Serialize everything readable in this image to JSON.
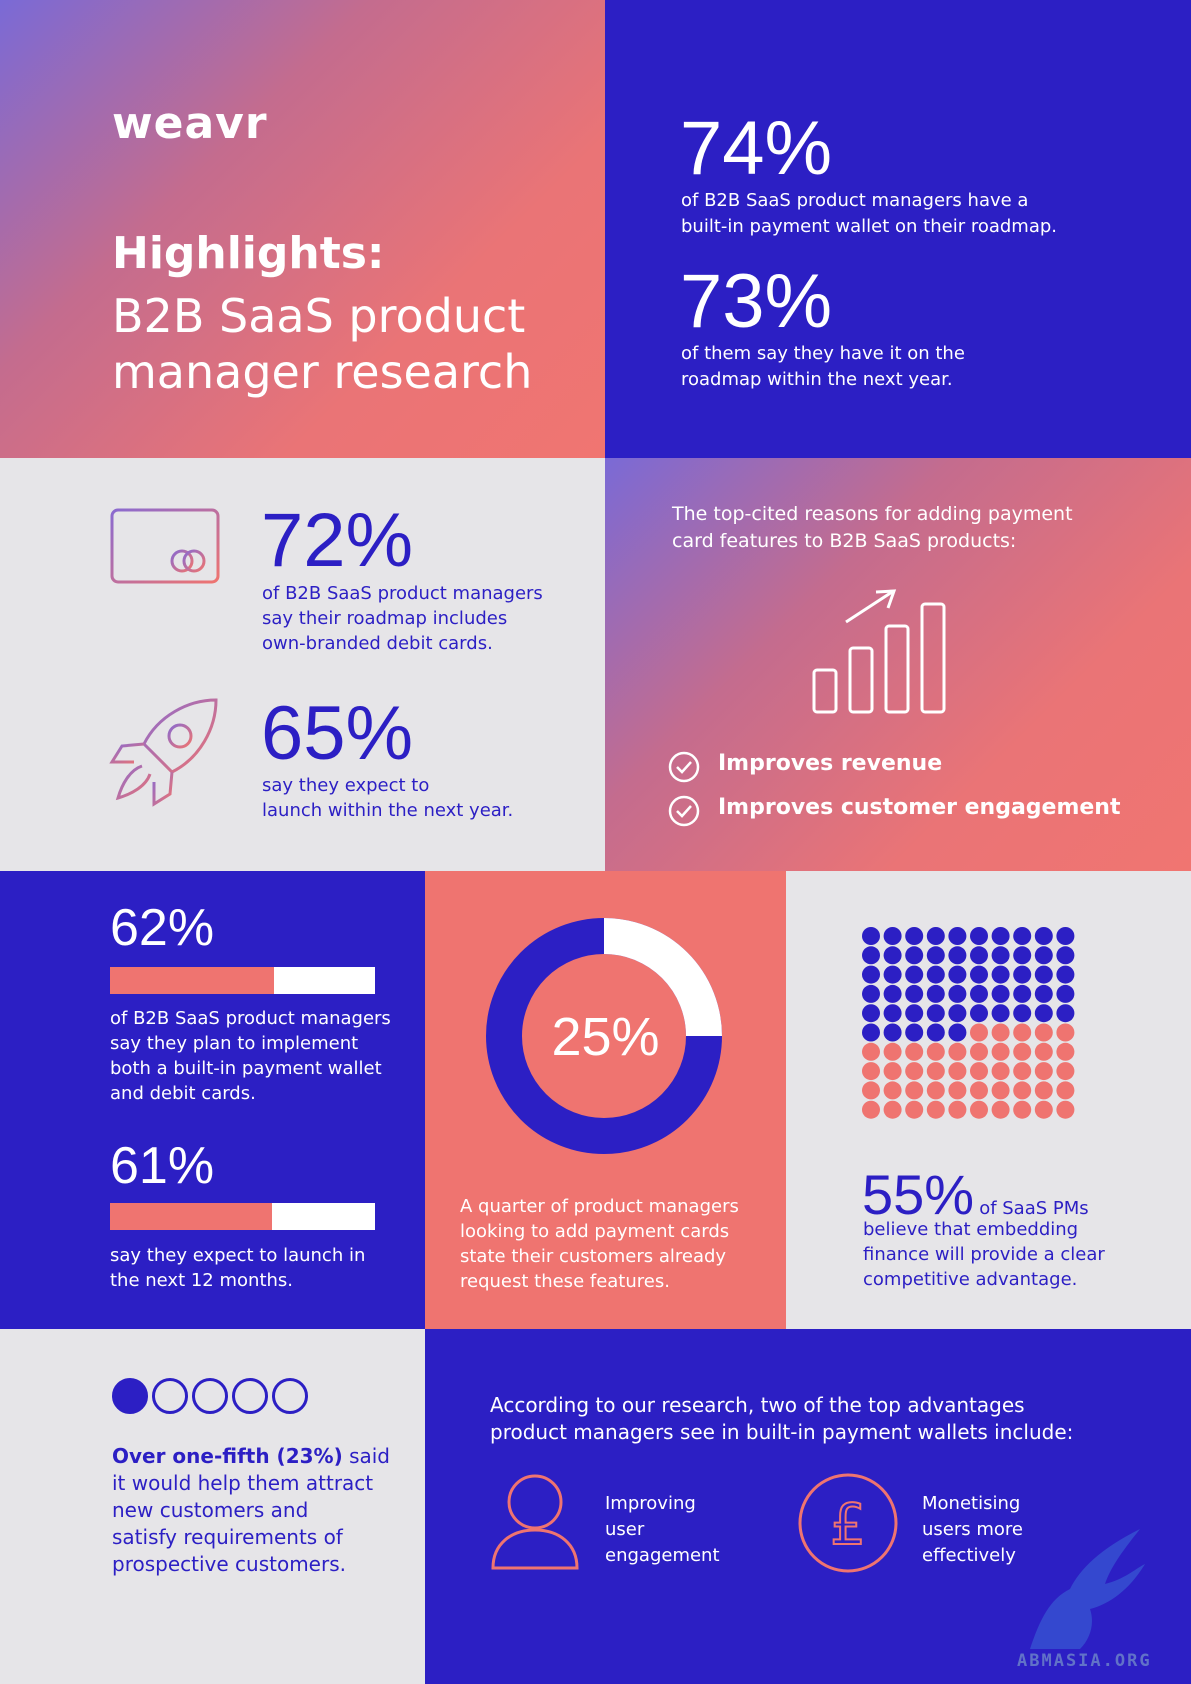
{
  "brand": {
    "logo": "weavr"
  },
  "hero": {
    "title": "Highlights:",
    "subtitle": "B2B SaaS product manager research"
  },
  "wallet_stats": [
    {
      "value": "74%",
      "text_line1": "of B2B SaaS product managers have a",
      "text_line2": "built-in payment wallet on their roadmap."
    },
    {
      "value": "73%",
      "text_line1": "of them say they have it on the",
      "text_line2": "roadmap within the next year."
    }
  ],
  "card_stats": [
    {
      "value": "72%",
      "text_line1": "of B2B SaaS product managers",
      "text_line2": "say their roadmap includes",
      "text_line3": "own-branded debit cards.",
      "icon": "credit-card-icon"
    },
    {
      "value": "65%",
      "text_line1": "say they expect to",
      "text_line2": "launch within the next year.",
      "icon": "rocket-icon"
    }
  ],
  "reasons": {
    "intro_line1": "The top-cited reasons for adding payment",
    "intro_line2": "card features to B2B SaaS products:",
    "items": [
      "Improves revenue",
      "Improves customer engagement"
    ]
  },
  "plan_stats": [
    {
      "value": "62%",
      "fraction": 0.62,
      "text_lines": [
        "of B2B SaaS product managers",
        "say they plan to implement",
        "both a built-in payment wallet",
        "and debit cards."
      ]
    },
    {
      "value": "61%",
      "fraction": 0.61,
      "text_lines": [
        "say they expect to launch in",
        "the next 12 months."
      ]
    }
  ],
  "donut": {
    "value": "25%",
    "fraction": 0.25,
    "text_lines": [
      "A quarter of product managers",
      "looking to add payment cards",
      "state their customers already",
      "request these features."
    ]
  },
  "waffle": {
    "value": "55%",
    "highlighted_fraction": 0.55,
    "inline_text": "of SaaS PMs",
    "text_lines": [
      "believe that embedding",
      "finance will provide a clear",
      "competitive advantage."
    ]
  },
  "fifth": {
    "filled_dots": 1,
    "total_dots": 5,
    "bold_text": "Over one-fifth (23%)",
    "rest_text": " said",
    "text_lines": [
      "it would help them attract",
      "new customers and",
      "satisfy requirements of",
      "prospective customers."
    ]
  },
  "advantages": {
    "intro_line1": "According to our research, two of the top advantages",
    "intro_line2": "product managers see in built-in payment wallets include:",
    "items": [
      {
        "icon": "user-icon",
        "lines": [
          "Improving",
          "user",
          "engagement"
        ]
      },
      {
        "icon": "pound-icon",
        "lines": [
          "Monetising",
          "users more",
          "effectively"
        ]
      }
    ]
  },
  "watermark": "ABMASIA.ORG",
  "colors": {
    "blue": "#2c1fc4",
    "coral": "#ef7470",
    "grey": "#e6e5e8",
    "white": "#ffffff"
  }
}
